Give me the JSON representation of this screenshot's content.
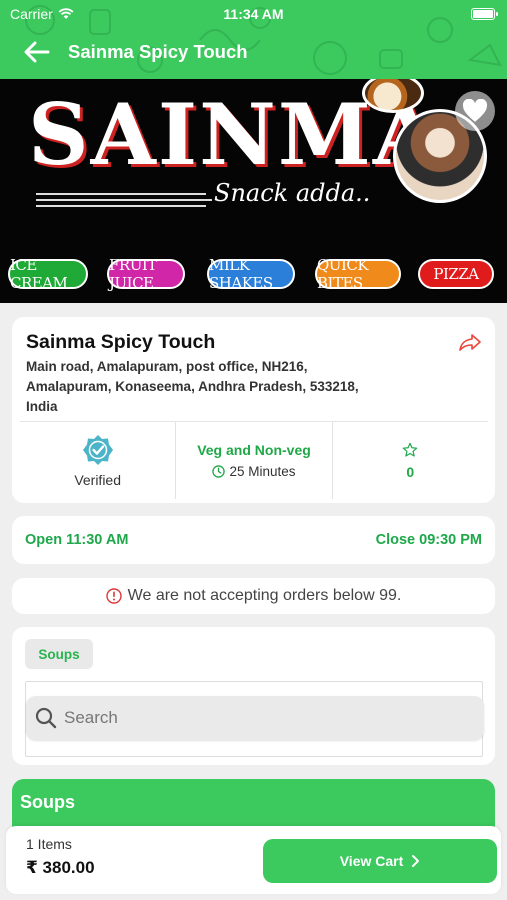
{
  "status_bar": {
    "carrier": "Carrier",
    "time": "11:34 AM"
  },
  "header": {
    "title": "Sainma Spicy Touch"
  },
  "banner": {
    "brand": "SAINMA",
    "tagline": "Snack adda..",
    "categories": [
      "ICE CREAM",
      "FRUIT JUICE",
      "MILK SHAKES",
      "QUICK BITES",
      "PIZZA"
    ]
  },
  "shop": {
    "name": "Sainma Spicy Touch",
    "address_lines": [
      "Main road, Amalapuram, post office, NH216,",
      "Amalapuram, Konaseema, Andhra Pradesh, 533218,",
      "India"
    ],
    "verified_label": "Verified",
    "food_type": "Veg and Non-veg",
    "delivery_time": "25 Minutes",
    "rating": "0"
  },
  "hours": {
    "open": "Open 11:30 AM",
    "close": "Close 09:30 PM"
  },
  "notice": {
    "text": "We are not accepting orders below 99."
  },
  "menu": {
    "selected_category": "Soups",
    "search_placeholder": "Search",
    "section_title": "Soups"
  },
  "cart": {
    "items": "1 Items",
    "total": "₹ 380.00",
    "button": "View Cart"
  },
  "colors": {
    "primary": "#3cc95e",
    "accent_text": "#1ea84a",
    "share_icon": "#e8473a",
    "notice_icon": "#d93a3a"
  }
}
